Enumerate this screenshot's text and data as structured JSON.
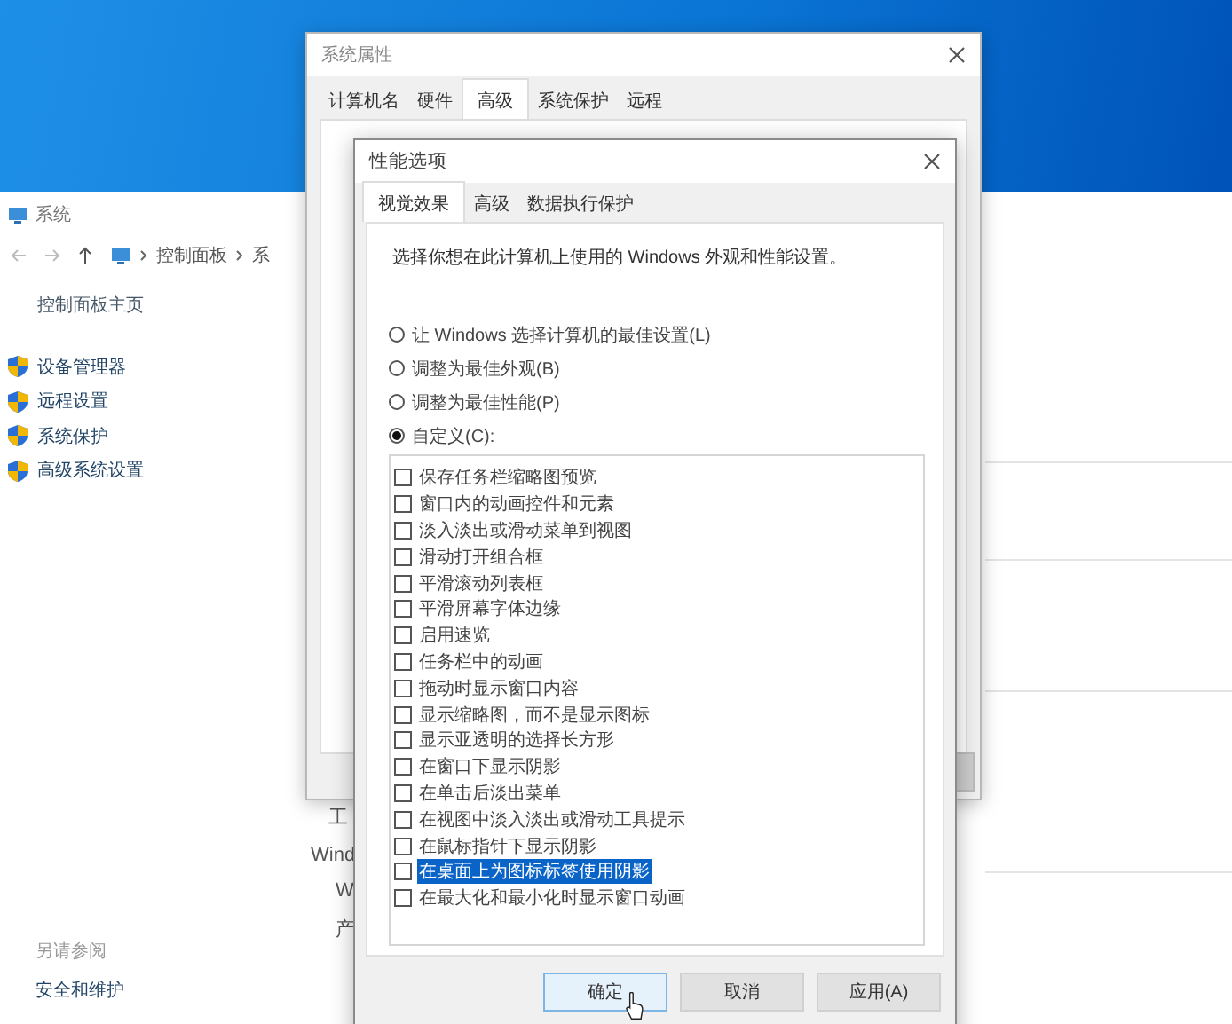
{
  "control_panel": {
    "title": "系统",
    "breadcrumb": [
      "控制面板",
      "系"
    ],
    "sidebar_home": "控制面板主页",
    "sidebar_items": [
      "设备管理器",
      "远程设置",
      "系统保护",
      "高级系统设置"
    ],
    "behind_fragments": [
      "工",
      "Wind",
      "W",
      "产"
    ],
    "see_also_heading": "另请参阅",
    "see_also_items": [
      "安全和维护"
    ]
  },
  "system_properties": {
    "title": "系统属性",
    "tabs": [
      {
        "label": "计算机名",
        "selected": false
      },
      {
        "label": "硬件",
        "selected": false
      },
      {
        "label": "高级",
        "selected": true
      },
      {
        "label": "系统保护",
        "selected": false
      },
      {
        "label": "远程",
        "selected": false
      }
    ]
  },
  "performance_options": {
    "title": "性能选项",
    "tabs": [
      {
        "label": "视觉效果",
        "selected": true
      },
      {
        "label": "高级",
        "selected": false
      },
      {
        "label": "数据执行保护",
        "selected": false
      }
    ],
    "description": "选择你想在此计算机上使用的 Windows 外观和性能设置。",
    "options": [
      {
        "label": "让 Windows 选择计算机的最佳设置(L)",
        "selected": false
      },
      {
        "label": "调整为最佳外观(B)",
        "selected": false
      },
      {
        "label": "调整为最佳性能(P)",
        "selected": false
      },
      {
        "label": "自定义(C):",
        "selected": true
      }
    ],
    "effects": [
      {
        "label": "保存任务栏缩略图预览",
        "checked": false,
        "selected": false
      },
      {
        "label": "窗口内的动画控件和元素",
        "checked": false,
        "selected": false
      },
      {
        "label": "淡入淡出或滑动菜单到视图",
        "checked": false,
        "selected": false
      },
      {
        "label": "滑动打开组合框",
        "checked": false,
        "selected": false
      },
      {
        "label": "平滑滚动列表框",
        "checked": false,
        "selected": false
      },
      {
        "label": "平滑屏幕字体边缘",
        "checked": false,
        "selected": false
      },
      {
        "label": "启用速览",
        "checked": false,
        "selected": false
      },
      {
        "label": "任务栏中的动画",
        "checked": false,
        "selected": false
      },
      {
        "label": "拖动时显示窗口内容",
        "checked": false,
        "selected": false
      },
      {
        "label": "显示缩略图，而不是显示图标",
        "checked": false,
        "selected": false
      },
      {
        "label": "显示亚透明的选择长方形",
        "checked": false,
        "selected": false
      },
      {
        "label": "在窗口下显示阴影",
        "checked": false,
        "selected": false
      },
      {
        "label": "在单击后淡出菜单",
        "checked": false,
        "selected": false
      },
      {
        "label": "在视图中淡入淡出或滑动工具提示",
        "checked": false,
        "selected": false
      },
      {
        "label": "在鼠标指针下显示阴影",
        "checked": false,
        "selected": false
      },
      {
        "label": "在桌面上为图标标签使用阴影",
        "checked": false,
        "selected": true
      },
      {
        "label": "在最大化和最小化时显示窗口动画",
        "checked": false,
        "selected": false
      }
    ],
    "buttons": [
      {
        "label": "确定",
        "kind": "default"
      },
      {
        "label": "取消",
        "kind": "normal"
      },
      {
        "label": "应用(A)",
        "kind": "normal"
      }
    ]
  }
}
